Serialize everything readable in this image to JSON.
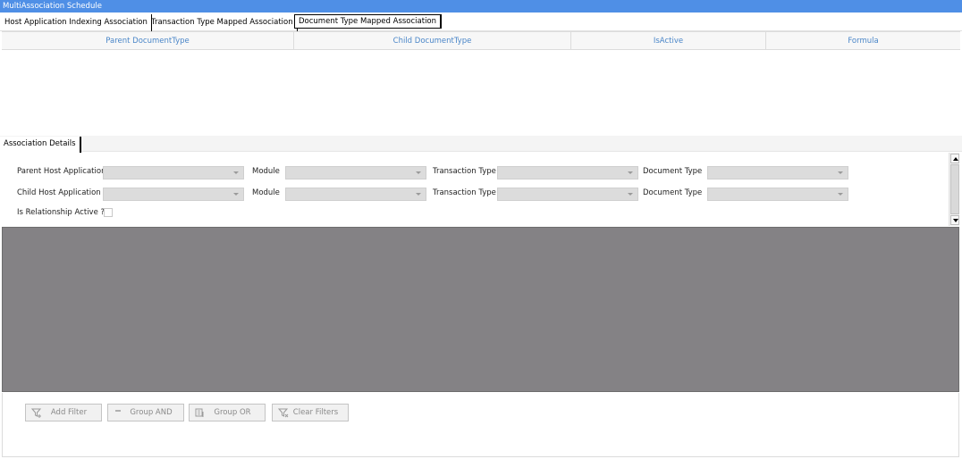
{
  "window": {
    "title": "MultiAssociation Schedule"
  },
  "top_tabs": [
    {
      "label": "Host Application Indexing Association"
    },
    {
      "label": "Transaction Type Mapped Association"
    },
    {
      "label": "Document Type Mapped Association",
      "active": true
    }
  ],
  "grid": {
    "columns": [
      "Parent DocumentType",
      "Child DocumentType",
      "IsActive",
      "Formula"
    ],
    "rows": []
  },
  "details_tab": {
    "label": "Association Details"
  },
  "form": {
    "row1": {
      "host_label": "Parent Host Application",
      "module_label": "Module",
      "transaction_label": "Transaction Type",
      "document_label": "Document Type"
    },
    "row2": {
      "host_label": "Child Host Application",
      "module_label": "Module",
      "transaction_label": "Transaction Type",
      "document_label": "Document Type"
    },
    "active_label": "Is Relationship Active ?",
    "active_checked": false
  },
  "filter_buttons": {
    "add_filter": "Add Filter",
    "group_and": "Group AND",
    "group_or": "Group OR",
    "clear_filters": "Clear Filters"
  },
  "colors": {
    "titlebar": "#4f8fe6",
    "header_text": "#4a86c8",
    "filter_canvas": "#848285"
  }
}
